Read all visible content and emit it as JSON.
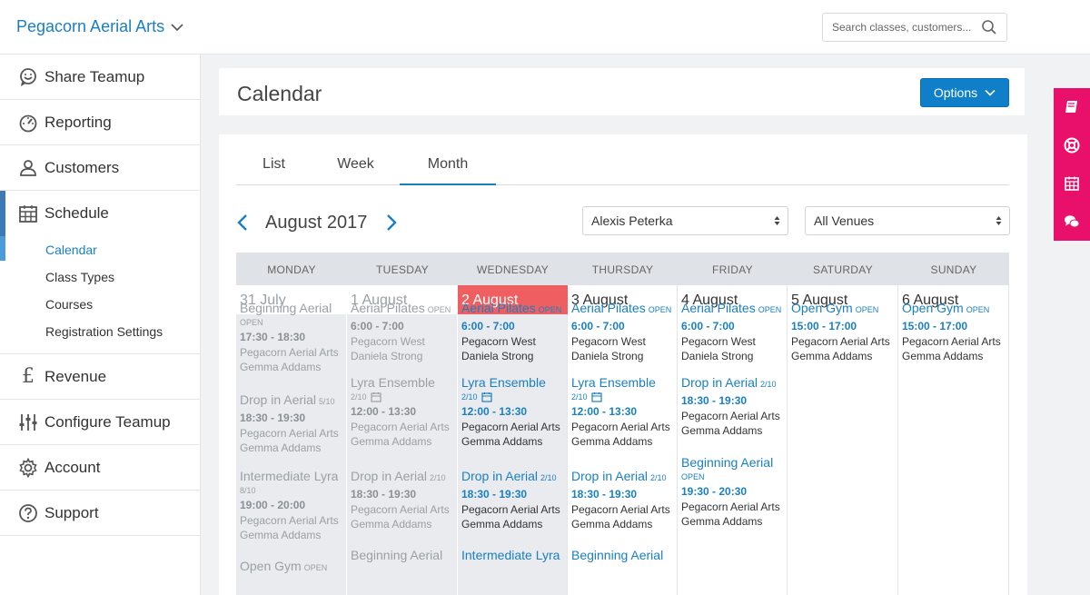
{
  "app": {
    "brand": "Pegacorn Aerial Arts",
    "search_placeholder": "Search classes, customers..."
  },
  "sidebar": {
    "items": [
      {
        "label": "Share Teamup",
        "icon": "chat-smile-icon"
      },
      {
        "label": "Reporting",
        "icon": "gauge-icon"
      },
      {
        "label": "Customers",
        "icon": "users-icon"
      },
      {
        "label": "Schedule",
        "icon": "calendar-icon"
      },
      {
        "label": "Revenue",
        "icon": "pound-icon",
        "glyph": "£"
      },
      {
        "label": "Configure Teamup",
        "icon": "sliders-icon"
      },
      {
        "label": "Account",
        "icon": "gear-icon"
      },
      {
        "label": "Support",
        "icon": "help-icon"
      }
    ],
    "schedule_sub": [
      "Calendar",
      "Class Types",
      "Courses",
      "Registration Settings"
    ]
  },
  "header": {
    "title": "Calendar",
    "options_label": "Options"
  },
  "view_tabs": [
    "List",
    "Week",
    "Month"
  ],
  "month_label": "August 2017",
  "filters": {
    "instructor": "Alexis Peterka",
    "venue": "All Venues"
  },
  "calendar": {
    "weekdays": [
      "MONDAY",
      "TUESDAY",
      "WEDNESDAY",
      "THURSDAY",
      "FRIDAY",
      "SATURDAY",
      "SUNDAY"
    ],
    "days": [
      {
        "label": "31 July",
        "state": "past",
        "events": [
          {
            "name": "Beginning Aerial",
            "tag": "OPEN",
            "time": "17:30 - 18:30",
            "venue": "Pegacorn Aerial Arts",
            "instructor": "Gemma Addams"
          },
          {
            "name": "Drop in Aerial",
            "tag": "5/10",
            "time": "18:30 - 19:30",
            "venue": "Pegacorn Aerial Arts",
            "instructor": "Gemma Addams"
          },
          {
            "name": "Intermediate Lyra",
            "tag": "8/10",
            "time": "19:00 - 20:00",
            "venue": "Pegacorn Aerial Arts",
            "instructor": "Gemma Addams"
          },
          {
            "name": "Open Gym",
            "tag": "OPEN",
            "time": "",
            "venue": "",
            "instructor": ""
          }
        ]
      },
      {
        "label": "1 August",
        "state": "past",
        "events": [
          {
            "name": "Aerial Pilates",
            "tag": "OPEN",
            "time": "6:00 - 7:00",
            "venue": "Pegacorn West",
            "instructor": "Daniela Strong"
          },
          {
            "name": "Lyra Ensemble",
            "tag": "2/10",
            "time": "12:00 - 13:30",
            "venue": "Pegacorn Aerial Arts",
            "instructor": "Gemma Addams"
          },
          {
            "name": "Drop in Aerial",
            "tag": "2/10",
            "time": "18:30 - 19:30",
            "venue": "Pegacorn Aerial Arts",
            "instructor": "Gemma Addams"
          },
          {
            "name": "Beginning Aerial",
            "tag": "",
            "time": "",
            "venue": "",
            "instructor": ""
          }
        ]
      },
      {
        "label": "2 August",
        "state": "today",
        "events": [
          {
            "name": "Aerial Pilates",
            "tag": "OPEN",
            "time": "6:00 - 7:00",
            "venue": "Pegacorn West",
            "instructor": "Daniela Strong"
          },
          {
            "name": "Lyra Ensemble",
            "tag": "2/10",
            "time": "12:00 - 13:30",
            "venue": "Pegacorn Aerial Arts",
            "instructor": "Gemma Addams"
          },
          {
            "name": "Drop in Aerial",
            "tag": "2/10",
            "time": "18:30 - 19:30",
            "venue": "Pegacorn Aerial Arts",
            "instructor": "Gemma Addams"
          },
          {
            "name": "Intermediate Lyra",
            "tag": "",
            "time": "",
            "venue": "",
            "instructor": ""
          }
        ]
      },
      {
        "label": "3 August",
        "state": "future",
        "events": [
          {
            "name": "Aerial Pilates",
            "tag": "OPEN",
            "time": "6:00 - 7:00",
            "venue": "Pegacorn West",
            "instructor": "Daniela Strong"
          },
          {
            "name": "Lyra Ensemble",
            "tag": "2/10",
            "time": "12:00 - 13:30",
            "venue": "Pegacorn Aerial Arts",
            "instructor": "Gemma Addams"
          },
          {
            "name": "Drop in Aerial",
            "tag": "2/10",
            "time": "18:30 - 19:30",
            "venue": "Pegacorn Aerial Arts",
            "instructor": "Gemma Addams"
          },
          {
            "name": "Beginning Aerial",
            "tag": "",
            "time": "",
            "venue": "",
            "instructor": ""
          }
        ]
      },
      {
        "label": "4 August",
        "state": "future",
        "events": [
          {
            "name": "Aerial Pilates",
            "tag": "OPEN",
            "time": "6:00 - 7:00",
            "venue": "Pegacorn West",
            "instructor": "Daniela Strong"
          },
          {
            "name": "Drop in Aerial",
            "tag": "2/10",
            "time": "18:30 - 19:30",
            "venue": "Pegacorn Aerial Arts",
            "instructor": "Gemma Addams"
          },
          {
            "name": "Beginning Aerial",
            "tag": "OPEN",
            "time": "19:30 - 20:30",
            "venue": "Pegacorn Aerial Arts",
            "instructor": "Gemma Addams"
          }
        ]
      },
      {
        "label": "5 August",
        "state": "future",
        "events": [
          {
            "name": "Open Gym",
            "tag": "OPEN",
            "time": "15:00 - 17:00",
            "venue": "Pegacorn Aerial Arts",
            "instructor": "Gemma Addams"
          }
        ]
      },
      {
        "label": "6 August",
        "state": "future",
        "events": [
          {
            "name": "Open Gym",
            "tag": "OPEN",
            "time": "15:00 - 17:00",
            "venue": "Pegacorn Aerial Arts",
            "instructor": "Gemma Addams"
          }
        ]
      }
    ]
  },
  "colors": {
    "accent": "#1a7fc1",
    "today": "#ef5f61",
    "side_tools": "#e8106b"
  },
  "side_tools": [
    "book-icon",
    "lifebuoy-icon",
    "calendar-icon",
    "chat-icon"
  ]
}
